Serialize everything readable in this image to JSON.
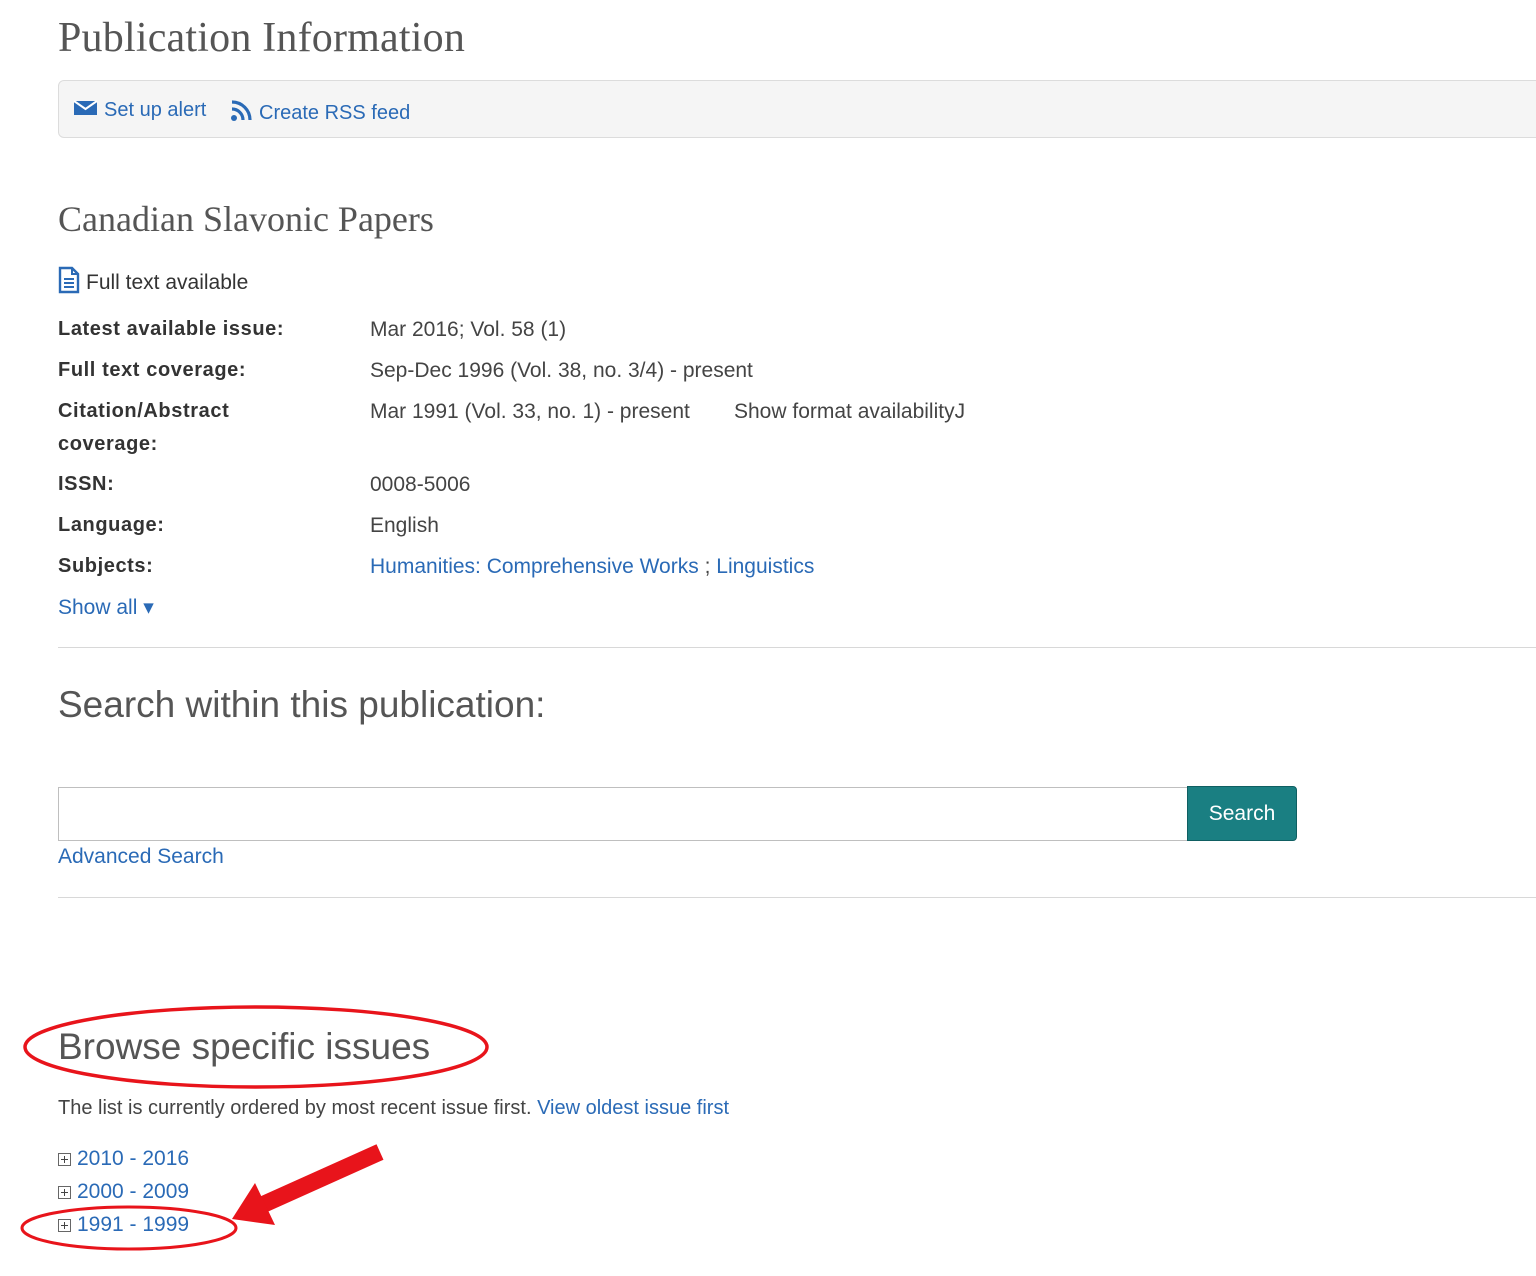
{
  "header": {
    "title": "Publication Information"
  },
  "toolbar": {
    "alert_label": "Set up alert",
    "rss_label": "Create RSS feed"
  },
  "publication": {
    "title": "Canadian Slavonic Papers",
    "fulltext_label": "Full text available",
    "fields": {
      "latest_label": "Latest available issue:",
      "latest_value": "Mar 2016; Vol. 58 (1)",
      "coverage_label": "Full text coverage:",
      "coverage_value": "Sep-Dec 1996 (Vol. 38, no. 3/4) - present",
      "citation_label_1": "Citation/Abstract",
      "citation_label_2": "coverage:",
      "citation_value": "Mar 1991 (Vol. 33, no. 1) - present",
      "format_link": "Show format availabilityJ",
      "issn_label": "ISSN:",
      "issn_value": "0008-5006",
      "language_label": "Language:",
      "language_value": "English",
      "subjects_label": "Subjects:",
      "subject_1": "Humanities: Comprehensive Works",
      "subject_sep": ";",
      "subject_2": "Linguistics"
    },
    "show_all": "Show all ▾"
  },
  "search": {
    "heading": "Search within this publication:",
    "input_value": "",
    "button_label": "Search",
    "advanced_link": "Advanced Search"
  },
  "browse": {
    "heading": "Browse specific issues",
    "order_text": "The list is currently ordered by most recent issue first.",
    "order_link": "View oldest issue first",
    "ranges": [
      "2010 - 2016",
      "2000 - 2009",
      "1991 - 1999"
    ]
  },
  "annotations": {
    "color": "#e8141b"
  },
  "colors": {
    "link": "#2a6ab6",
    "button": "#1a7f82"
  },
  "icons": [
    "envelope-icon",
    "rss-icon",
    "document-icon",
    "expand-plus-icon",
    "red-arrow-annotation",
    "red-ellipse-annotation"
  ]
}
